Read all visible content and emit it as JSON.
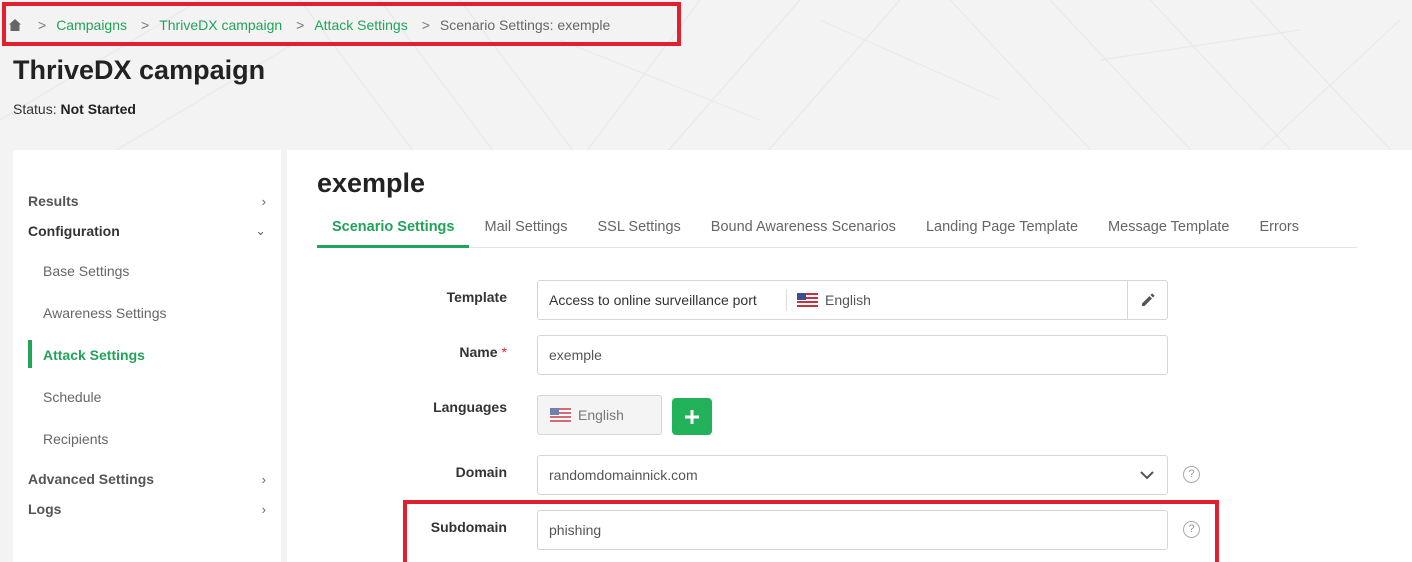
{
  "breadcrumb": {
    "items": [
      {
        "label": "Campaigns"
      },
      {
        "label": "ThriveDX campaign"
      },
      {
        "label": "Attack Settings"
      }
    ],
    "current": "Scenario Settings: exemple"
  },
  "page": {
    "title": "ThriveDX campaign",
    "status_label": "Status:",
    "status_value": "Not Started"
  },
  "sidebar": {
    "results": "Results",
    "configuration": "Configuration",
    "sub_items": [
      "Base Settings",
      "Awareness Settings",
      "Attack Settings",
      "Schedule",
      "Recipients"
    ],
    "advanced": "Advanced Settings",
    "logs": "Logs"
  },
  "scenario": {
    "name": "exemple",
    "tabs": [
      "Scenario Settings",
      "Mail Settings",
      "SSL Settings",
      "Bound Awareness Scenarios",
      "Landing Page Template",
      "Message Template",
      "Errors"
    ]
  },
  "form": {
    "template": {
      "label": "Template",
      "value": "Access to online surveillance port",
      "language": "English"
    },
    "name": {
      "label": "Name",
      "required_mark": "*",
      "value": "exemple"
    },
    "languages": {
      "label": "Languages",
      "value": "English"
    },
    "domain": {
      "label": "Domain",
      "value": "randomdomainnick.com"
    },
    "subdomain": {
      "label": "Subdomain",
      "value": "phishing"
    },
    "help_glyph": "?"
  },
  "colors": {
    "accent": "#22a35a",
    "annotation": "#e0202f"
  }
}
